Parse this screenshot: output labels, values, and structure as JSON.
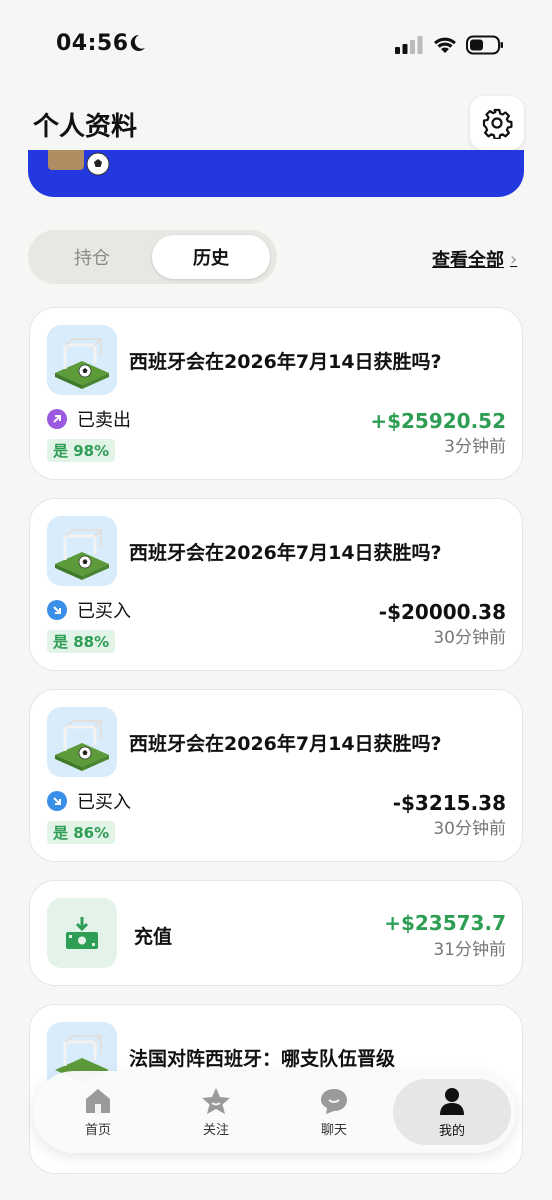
{
  "status_bar": {
    "time": "04:56"
  },
  "header": {
    "title": "个人资料"
  },
  "banner": {
    "text": "…"
  },
  "segment": {
    "tab_holdings": "持仓",
    "tab_history": "历史",
    "view_all": "查看全部"
  },
  "history": [
    {
      "question": "西班牙会在2026年7月14日获胜吗?",
      "action": "已卖出",
      "action_icon": "arrow-up-right-icon",
      "action_color": "#9b59e0",
      "badge": "是 98%",
      "amount": "+$25920.52",
      "amount_color": "#2f9e55",
      "time": "3分钟前"
    },
    {
      "question": "西班牙会在2026年7月14日获胜吗?",
      "action": "已买入",
      "action_icon": "arrow-down-right-icon",
      "action_color": "#3a8fe8",
      "badge": "是 88%",
      "amount": "-$20000.38",
      "amount_color": "#111111",
      "time": "30分钟前"
    },
    {
      "question": "西班牙会在2026年7月14日获胜吗?",
      "action": "已买入",
      "action_icon": "arrow-down-right-icon",
      "action_color": "#3a8fe8",
      "badge": "是 86%",
      "amount": "-$3215.38",
      "amount_color": "#111111",
      "time": "30分钟前"
    },
    {
      "type": "deposit",
      "label": "充值",
      "amount": "+$23573.7",
      "amount_color": "#2f9e55",
      "time": "31分钟前"
    },
    {
      "question": "法国对阵西班牙：哪支队伍晋级"
    }
  ],
  "tabbar": [
    {
      "label": "首页",
      "icon": "home-icon"
    },
    {
      "label": "关注",
      "icon": "star-icon"
    },
    {
      "label": "聊天",
      "icon": "chat-icon"
    },
    {
      "label": "我的",
      "icon": "person-icon",
      "active": true
    }
  ]
}
